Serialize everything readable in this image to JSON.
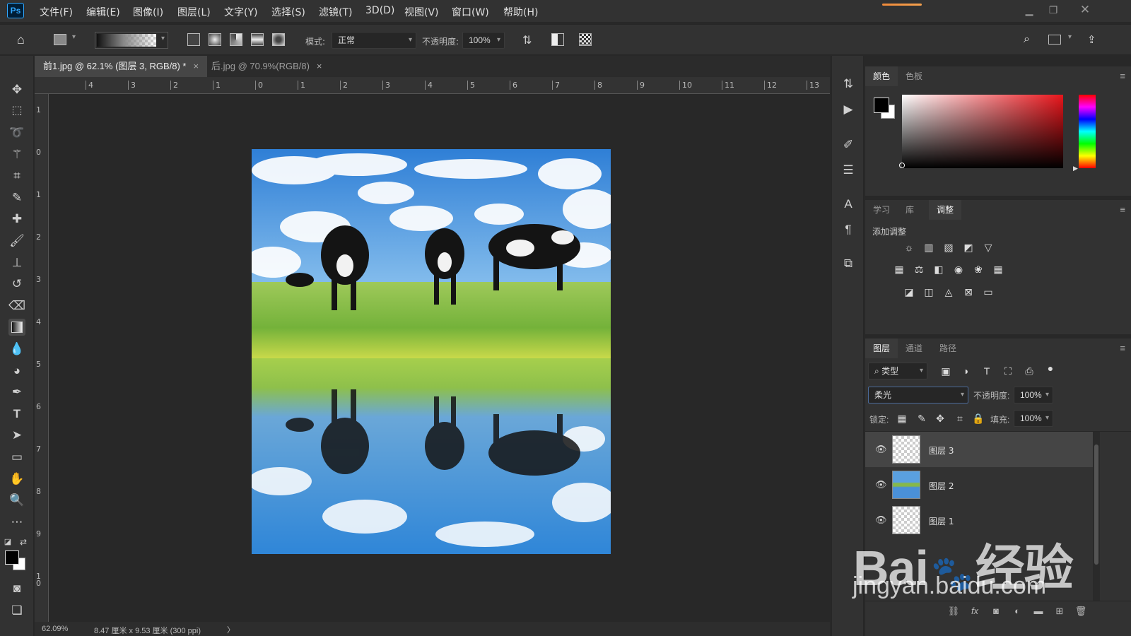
{
  "app": {
    "logo": "Ps"
  },
  "menu": [
    "文件(F)",
    "编辑(E)",
    "图像(I)",
    "图层(L)",
    "文字(Y)",
    "选择(S)",
    "滤镜(T)",
    "3D(D)",
    "视图(V)",
    "窗口(W)",
    "帮助(H)"
  ],
  "options": {
    "mode_label": "模式:",
    "mode_value": "正常",
    "opacity_label": "不透明度:",
    "opacity_value": "100%"
  },
  "tabs": [
    {
      "label": "前1.jpg @ 62.1% (图层 3, RGB/8) *",
      "close": "×"
    },
    {
      "label": "后.jpg @ 70.9%(RGB/8)",
      "close": "×"
    }
  ],
  "rulers": {
    "horizontal": [
      "4",
      "3",
      "2",
      "1",
      "0",
      "1",
      "2",
      "3",
      "4",
      "5",
      "6",
      "7",
      "8",
      "9",
      "10",
      "11",
      "12",
      "13"
    ],
    "vertical": [
      "1",
      "0",
      "1",
      "2",
      "3",
      "4",
      "5",
      "6",
      "7",
      "8",
      "9",
      "1\n0"
    ]
  },
  "status": {
    "zoom": "62.09%",
    "doc_size": "8.47 厘米 x 9.53 厘米 (300 ppi)",
    "arrow": "〉"
  },
  "color_panel": {
    "tabs": [
      "颜色",
      "色板"
    ],
    "active": 0
  },
  "adjust_panel": {
    "tabs": [
      "学习",
      "库",
      "调整"
    ],
    "active": 2,
    "title": "添加调整"
  },
  "layers_panel": {
    "tabs": [
      "图层",
      "通道",
      "路径"
    ],
    "active": 0,
    "filter_label": "类型",
    "blend_mode": "柔光",
    "opacity_label": "不透明度:",
    "opacity_value": "100%",
    "lock_label": "锁定:",
    "fill_label": "填充:",
    "fill_value": "100%",
    "layers": [
      {
        "name": "图层 3",
        "selected": true
      },
      {
        "name": "图层 2",
        "selected": false
      },
      {
        "name": "图层 1",
        "selected": false
      }
    ]
  },
  "watermark": {
    "brand": "Bai",
    "cn": "经验",
    "url": "jingyan.baidu.com"
  }
}
